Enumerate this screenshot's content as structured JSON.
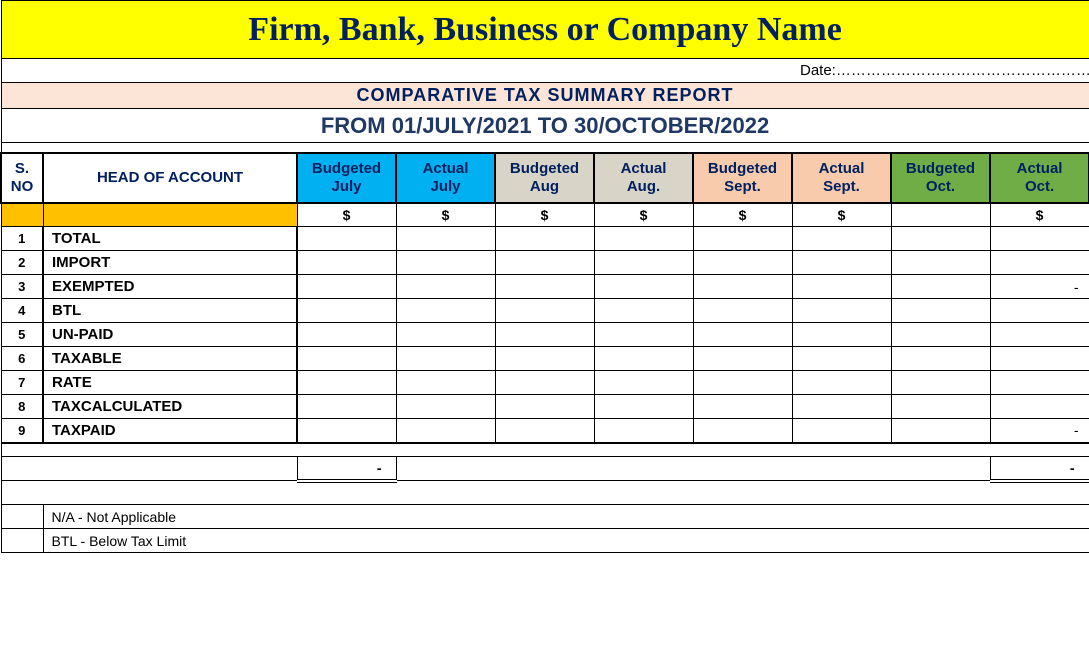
{
  "header": {
    "title": "Firm, Bank, Business or Company  Name",
    "date_label": "Date:………………………………………………",
    "report_title": "COMPARATIVE TAX  SUMMARY REPORT",
    "date_range": "FROM 01/JULY/2021  TO 30/OCTOBER/2022"
  },
  "columns": {
    "sno": "S. NO",
    "account": "HEAD OF ACCOUNT",
    "months": [
      {
        "label": "Budgeted\nJuly",
        "currency": "$"
      },
      {
        "label": "Actual\nJuly",
        "currency": "$"
      },
      {
        "label": "Budgeted\nAug",
        "currency": "$"
      },
      {
        "label": "Actual\nAug.",
        "currency": "$"
      },
      {
        "label": "Budgeted\nSept.",
        "currency": "$"
      },
      {
        "label": "Actual\nSept.",
        "currency": "$"
      },
      {
        "label": "Budgeted\nOct.",
        "currency": ""
      },
      {
        "label": "Actual\nOct.",
        "currency": "$"
      }
    ]
  },
  "rows": [
    {
      "sno": "1",
      "account": " TOTAL",
      "vals": [
        "",
        "",
        "",
        "",
        "",
        "",
        "",
        ""
      ]
    },
    {
      "sno": "2",
      "account": "IMPORT",
      "vals": [
        "",
        "",
        "",
        "",
        "",
        "",
        "",
        ""
      ]
    },
    {
      "sno": "3",
      "account": "EXEMPTED",
      "vals": [
        "",
        "",
        "",
        "",
        "",
        "",
        "",
        "-"
      ]
    },
    {
      "sno": "4",
      "account": "BTL",
      "vals": [
        "",
        "",
        "",
        "",
        "",
        "",
        "",
        ""
      ]
    },
    {
      "sno": "5",
      "account": "UN-PAID",
      "vals": [
        "",
        "",
        "",
        "",
        "",
        "",
        "",
        ""
      ]
    },
    {
      "sno": "6",
      "account": "TAXABLE",
      "vals": [
        "",
        "",
        "",
        "",
        "",
        "",
        "",
        ""
      ]
    },
    {
      "sno": "7",
      "account": "RATE",
      "vals": [
        "",
        "",
        "",
        "",
        "",
        "",
        "",
        ""
      ]
    },
    {
      "sno": "8",
      "account": "TAXCALCULATED",
      "vals": [
        "",
        "",
        "",
        "",
        "",
        "",
        "",
        ""
      ]
    },
    {
      "sno": "9",
      "account": "TAXPAID",
      "vals": [
        "",
        "",
        "",
        "",
        "",
        "",
        "",
        "-"
      ]
    }
  ],
  "summary": {
    "vals": [
      "-",
      "",
      "",
      "",
      "",
      "",
      "",
      "-"
    ]
  },
  "legend": [
    "N/A - Not Applicable",
    "BTL - Below Tax Limit"
  ]
}
